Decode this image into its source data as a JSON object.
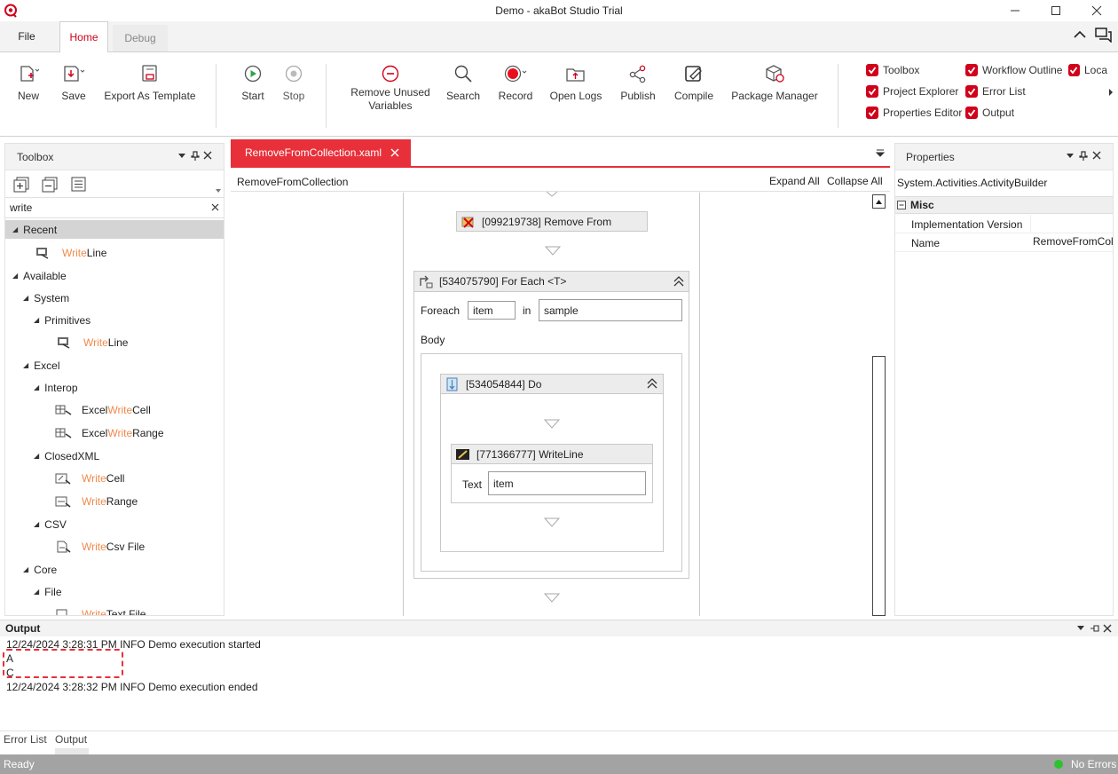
{
  "window": {
    "title": "Demo - akaBot Studio Trial"
  },
  "ribbon": {
    "tabs": [
      "File",
      "Home",
      "Debug"
    ],
    "buttons": {
      "new": "New",
      "save": "Save",
      "export": "Export As Template",
      "start": "Start",
      "stop": "Stop",
      "remove_unused_1": "Remove Unused",
      "remove_unused_2": "Variables",
      "search": "Search",
      "record": "Record",
      "open_logs": "Open Logs",
      "publish": "Publish",
      "compile": "Compile",
      "package_manager": "Package Manager"
    },
    "view_toggles": {
      "toolbox": "Toolbox",
      "project_explorer": "Project Explorer",
      "properties_editor": "Properties Editor",
      "workflow_outline": "Workflow Outline",
      "error_list": "Error List",
      "output": "Output",
      "locals": "Loca"
    }
  },
  "toolbox": {
    "title": "Toolbox",
    "search_value": "write",
    "recent": "Recent",
    "available": "Available",
    "system": "System",
    "primitives": "Primitives",
    "excel": "Excel",
    "interop": "Interop",
    "closedxml": "ClosedXML",
    "csv": "CSV",
    "core": "Core",
    "file": "File",
    "match": "Write",
    "match_lower": "Write",
    "items": {
      "recent_writeline_suffix": "Line",
      "writeline_suffix": "Line",
      "excel_write_cell_prefix": "Excel ",
      "excel_write_cell_suffix": " Cell",
      "excel_write_range_prefix": "Excel ",
      "excel_write_range_suffix": " Range",
      "write_cell_suffix": " Cell",
      "write_range_suffix": " Range",
      "write_csv_suffix": " Csv File",
      "write_text_suffix": " Text File"
    }
  },
  "designer": {
    "tab": "RemoveFromCollection.xaml",
    "breadcrumb": "RemoveFromCollection",
    "expand_all": "Expand All",
    "collapse_all": "Collapse All",
    "remove_from": "[099219738] Remove From",
    "foreach_title": "[534075790] For Each <T>",
    "foreach_label": "Foreach",
    "foreach_var": "item",
    "in_label": "in",
    "foreach_collection": "sample",
    "body_label": "Body",
    "do_title": "[534054844] Do",
    "writeline_title": "[771366777] WriteLine",
    "text_label": "Text",
    "text_value": "item"
  },
  "properties": {
    "title": "Properties",
    "object": "System.Activities.ActivityBuilder",
    "category": "Misc",
    "rows": [
      {
        "name": "Implementation Version",
        "value": ""
      },
      {
        "name": "Name",
        "value": "RemoveFromCol"
      }
    ]
  },
  "output": {
    "title": "Output",
    "lines": [
      "12/24/2024 3:28:31 PM INFO Demo execution started",
      "A",
      "C",
      "12/24/2024 3:28:32 PM INFO Demo execution ended"
    ]
  },
  "bottom_tabs": [
    "Error List",
    "Output"
  ],
  "status": {
    "left": "Ready",
    "right": "No Errors"
  }
}
